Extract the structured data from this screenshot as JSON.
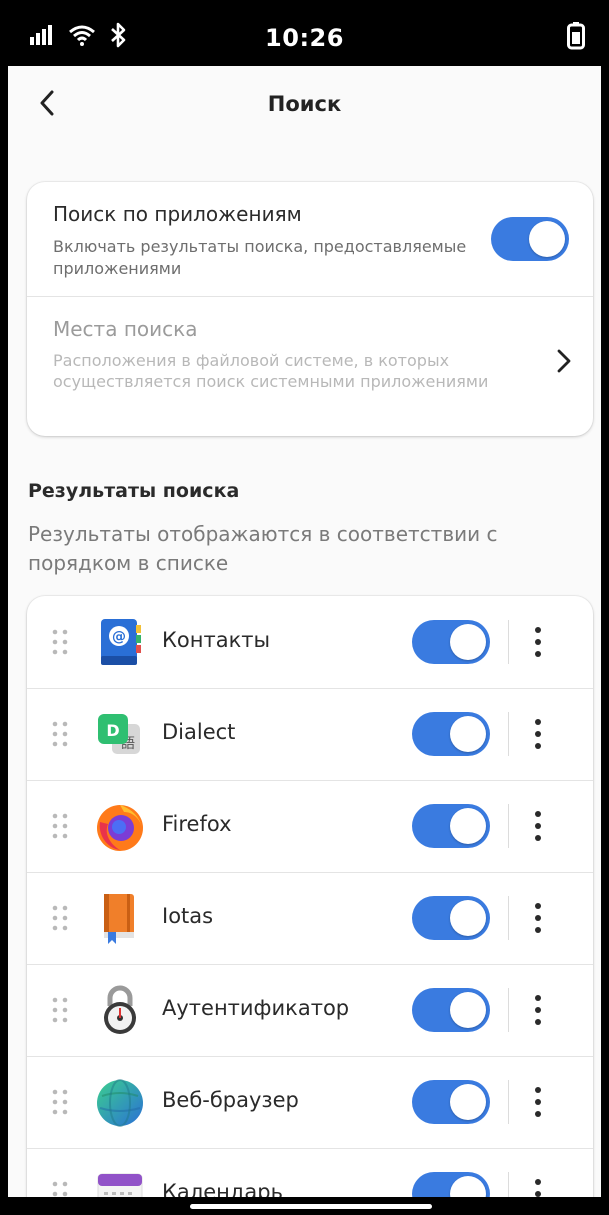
{
  "status_bar": {
    "time": "10:26",
    "icons": [
      "signal-icon",
      "wifi-icon",
      "bluetooth-icon",
      "battery-icon"
    ]
  },
  "header": {
    "title": "Поиск",
    "back_icon": "chevron-left-icon"
  },
  "settings": {
    "app_search": {
      "title": "Поиск по приложениям",
      "subtitle": "Включать результаты поиска, предоставляемые приложениями",
      "enabled": true
    },
    "search_locations": {
      "title": "Места поиска",
      "subtitle": "Расположения в файловой системе, в которых осуществляется поиск системными приложениями",
      "disabled_look": true
    }
  },
  "results": {
    "title": "Результаты поиска",
    "subtitle": "Результаты отображаются в соответствии с порядком в списке",
    "apps": [
      {
        "name": "Контакты",
        "icon": "contacts-icon",
        "enabled": true
      },
      {
        "name": "Dialect",
        "icon": "dialect-icon",
        "enabled": true
      },
      {
        "name": "Firefox",
        "icon": "firefox-icon",
        "enabled": true
      },
      {
        "name": "Iotas",
        "icon": "iotas-icon",
        "enabled": true
      },
      {
        "name": "Аутентификатор",
        "icon": "authenticator-icon",
        "enabled": true
      },
      {
        "name": "Веб-браузер",
        "icon": "web-browser-icon",
        "enabled": true
      },
      {
        "name": "Календарь",
        "icon": "calendar-icon",
        "enabled": true
      }
    ]
  },
  "colors": {
    "accent": "#3a7be0",
    "background": "#fafafa",
    "card": "#ffffff"
  }
}
